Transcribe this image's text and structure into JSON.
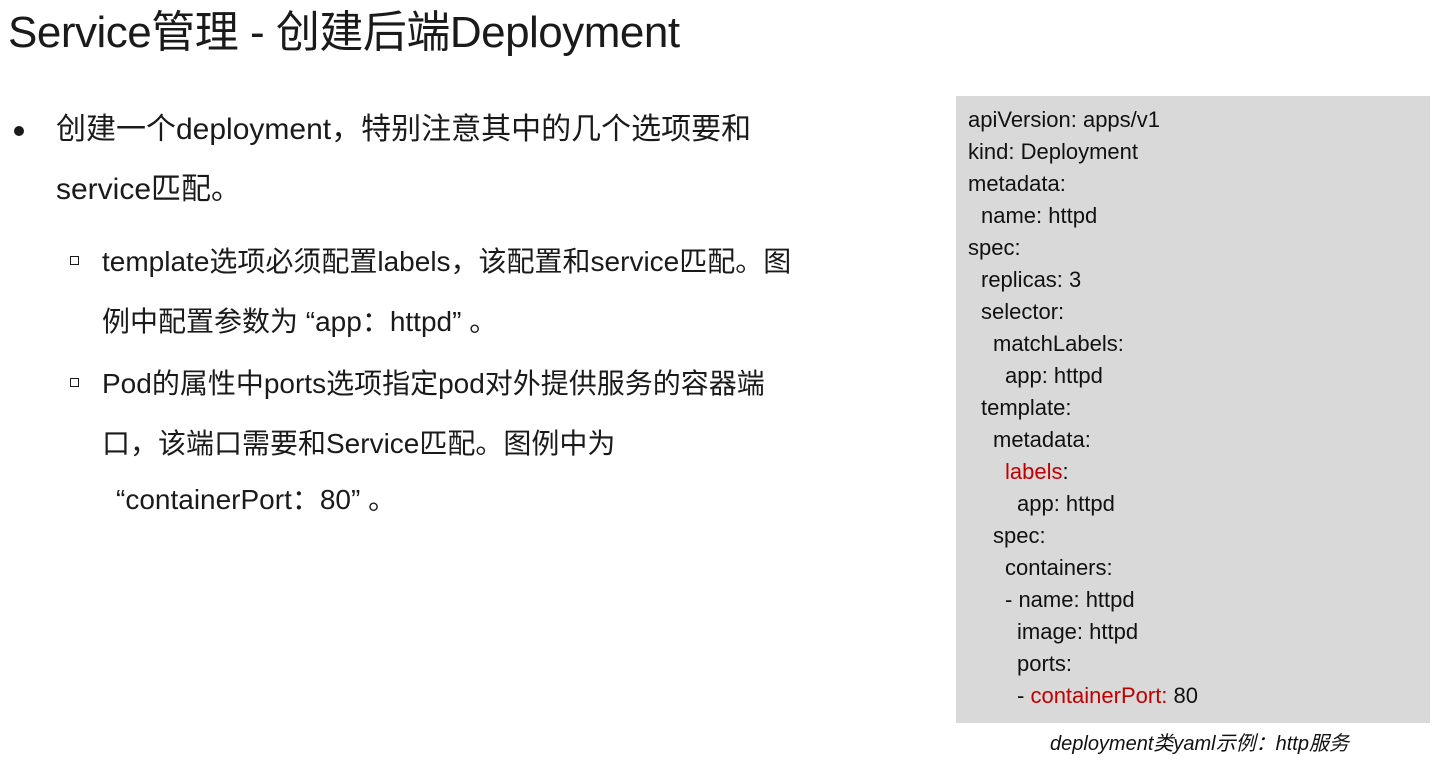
{
  "slide": {
    "title": "Service管理 - 创建后端Deployment",
    "bullet": {
      "line1": "创建一个deployment，特别注意其中的几个选项要和",
      "line2": "service匹配。"
    },
    "sub1": {
      "line1": "template选项必须配置labels，该配置和service匹配。图",
      "line2": "例中配置参数为 “app：httpd” 。"
    },
    "sub2": {
      "line1": "Pod的属性中ports选项指定pod对外提供服务的容器端",
      "line2": "口，该端口需要和Service匹配。图例中为",
      "line3": "“containerPort：80” 。"
    }
  },
  "code": {
    "l01": "apiVersion: apps/v1",
    "l02": "kind: Deployment",
    "l03": "metadata:",
    "l04": "name: httpd",
    "l05": "spec:",
    "l06": "replicas: 3",
    "l07": "selector:",
    "l08": "matchLabels:",
    "l09": "app: httpd",
    "l10": "template:",
    "l11": "metadata:",
    "l12_key": "labels",
    "l12_colon": ":",
    "l13": "app: httpd",
    "l14": "spec:",
    "l15": "containers:",
    "l16": "- name: httpd",
    "l17": "image: httpd",
    "l18": "ports:",
    "l19_dash": "- ",
    "l19_key": "containerPort:",
    "l19_val": " 80",
    "highlight_color": "#c00000",
    "background_color": "#d9d9d9"
  },
  "caption": "deployment类yaml示例：http服务"
}
